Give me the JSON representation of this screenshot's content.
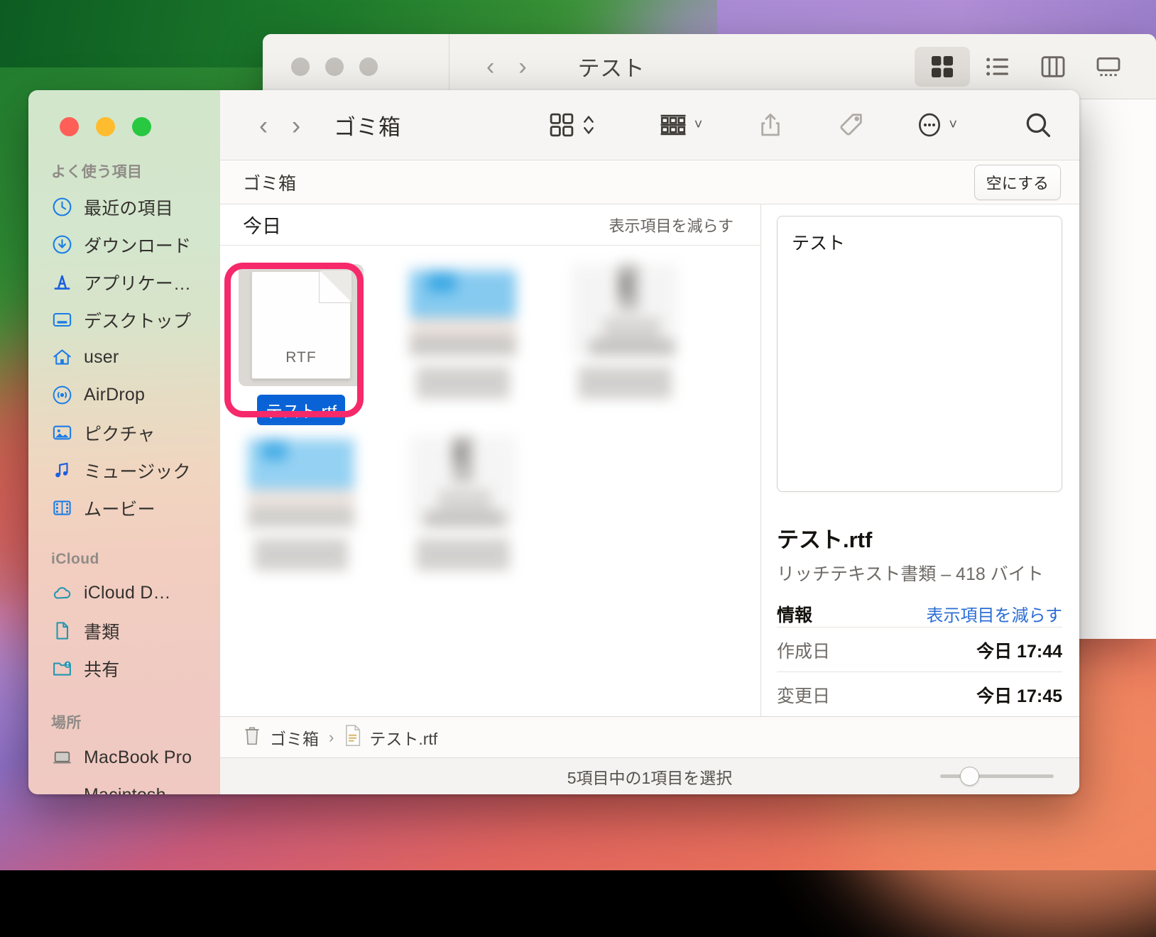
{
  "background_window": {
    "title": "テスト",
    "back_icon": "chevron-left-icon",
    "forward_icon": "chevron-right-icon",
    "view_buttons": [
      "icon-view-icon",
      "list-view-icon",
      "column-view-icon",
      "gallery-view-icon"
    ]
  },
  "window": {
    "traffic_lights": [
      "close-button",
      "minimize-button",
      "zoom-button"
    ],
    "colors": {
      "accent_blue": "#0a63d6",
      "annotation_pink": "#f6296b",
      "link_blue": "#2a6dd4",
      "sidebar_icon_blue": "#1a7ce8",
      "sidebar_icon_teal": "#2196b0"
    }
  },
  "toolbar": {
    "back_label": "‹",
    "forward_label": "›",
    "title": "ゴミ箱",
    "buttons": [
      {
        "name": "view-mode-icon",
        "label": "表示方法"
      },
      {
        "name": "group-by-icon",
        "label": "グループ分け"
      },
      {
        "name": "share-icon",
        "label": "共有"
      },
      {
        "name": "tag-icon",
        "label": "タグ"
      },
      {
        "name": "more-icon",
        "label": "その他"
      },
      {
        "name": "search-icon",
        "label": "検索"
      }
    ]
  },
  "trash_bar": {
    "label": "ゴミ箱",
    "empty_button": "空にする"
  },
  "group_bar": {
    "title": "今日",
    "toggle": "表示項目を減らす"
  },
  "files": [
    {
      "name": "テスト.rtf",
      "ext": "RTF",
      "selected": true,
      "annotated": true
    },
    {
      "name": "",
      "ext": "",
      "selected": false,
      "annotated": false
    },
    {
      "name": "",
      "ext": "",
      "selected": false,
      "annotated": false
    },
    {
      "name": "",
      "ext": "",
      "selected": false,
      "annotated": false
    },
    {
      "name": "",
      "ext": "",
      "selected": false,
      "annotated": false
    }
  ],
  "info_pane": {
    "preview_text": "テスト",
    "file_name": "テスト.rtf",
    "subtitle": "リッチテキスト書類 – 418 バイト",
    "section_header": "情報",
    "section_toggle": "表示項目を減らす",
    "metadata": [
      {
        "key": "作成日",
        "value": "今日 17:44"
      },
      {
        "key": "変更日",
        "value": "今日 17:45"
      }
    ]
  },
  "path_bar": {
    "items": [
      {
        "icon": "trash-icon",
        "label": "ゴミ箱"
      },
      {
        "icon": "rtf-document-icon",
        "label": "テスト.rtf"
      }
    ],
    "separator": "›"
  },
  "status_bar": {
    "text": "5項目中の1項目を選択",
    "zoom_slider_value": 20
  },
  "sidebar": {
    "sections": [
      {
        "header": "よく使う項目",
        "items": [
          {
            "label": "最近の項目",
            "icon": "clock-icon"
          },
          {
            "label": "ダウンロード",
            "icon": "download-circle-icon"
          },
          {
            "label": "アプリケー…",
            "icon": "applications-icon"
          },
          {
            "label": "デスクトップ",
            "icon": "desktop-icon"
          },
          {
            "label": "user",
            "icon": "home-icon"
          },
          {
            "label": "AirDrop",
            "icon": "airdrop-icon"
          },
          {
            "label": "ピクチャ",
            "icon": "pictures-icon"
          },
          {
            "label": "ミュージック",
            "icon": "music-icon"
          },
          {
            "label": "ムービー",
            "icon": "movies-icon"
          }
        ]
      },
      {
        "header": "iCloud",
        "items": [
          {
            "label": "iCloud D…",
            "icon": "icloud-icon"
          },
          {
            "label": "書類",
            "icon": "documents-icon"
          },
          {
            "label": "共有",
            "icon": "shared-folder-icon"
          }
        ]
      },
      {
        "header": "場所",
        "items": [
          {
            "label": "MacBook Pro",
            "icon": "laptop-icon"
          },
          {
            "label": "Macintosh",
            "icon": "disk-icon"
          }
        ]
      }
    ]
  }
}
